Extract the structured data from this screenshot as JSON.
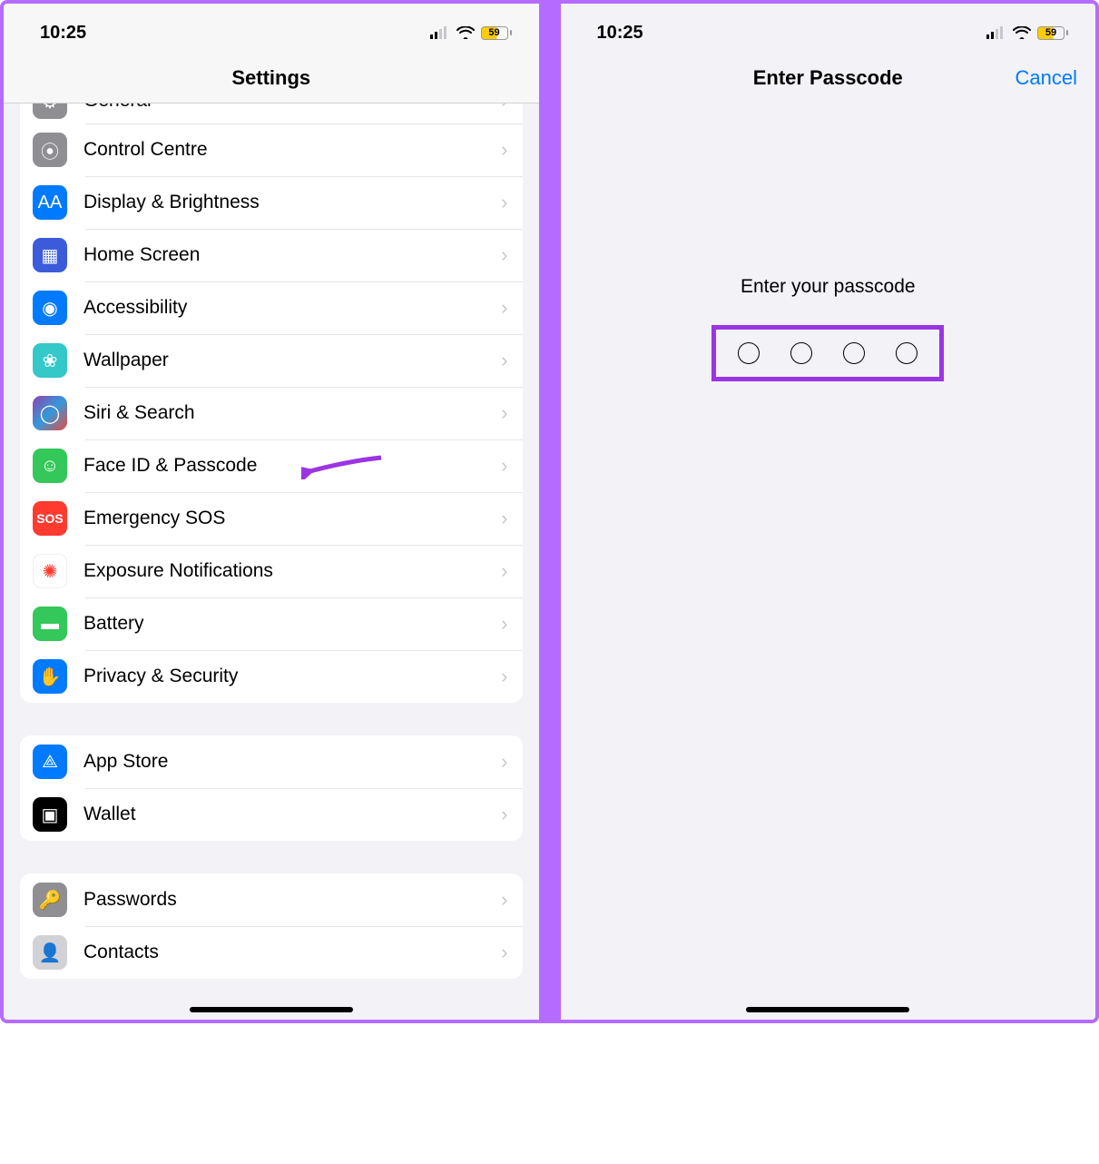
{
  "status": {
    "time": "10:25",
    "battery": "59"
  },
  "left": {
    "title": "Settings",
    "group1": [
      {
        "id": "general",
        "label": "General",
        "iconClass": "ic-general",
        "glyph": "⚙"
      },
      {
        "id": "control",
        "label": "Control Centre",
        "iconClass": "ic-control",
        "glyph": "⦿"
      },
      {
        "id": "display",
        "label": "Display & Brightness",
        "iconClass": "ic-display",
        "glyph": "AA"
      },
      {
        "id": "home",
        "label": "Home Screen",
        "iconClass": "ic-home",
        "glyph": "▦"
      },
      {
        "id": "access",
        "label": "Accessibility",
        "iconClass": "ic-access",
        "glyph": "◉"
      },
      {
        "id": "wall",
        "label": "Wallpaper",
        "iconClass": "ic-wall",
        "glyph": "❀"
      },
      {
        "id": "siri",
        "label": "Siri & Search",
        "iconClass": "ic-siri",
        "glyph": "◯"
      },
      {
        "id": "face",
        "label": "Face ID & Passcode",
        "iconClass": "ic-face",
        "glyph": "☺"
      },
      {
        "id": "sos",
        "label": "Emergency SOS",
        "iconClass": "ic-sos",
        "glyph": "SOS"
      },
      {
        "id": "expo",
        "label": "Exposure Notifications",
        "iconClass": "ic-expo",
        "glyph": "✺"
      },
      {
        "id": "batt",
        "label": "Battery",
        "iconClass": "ic-batt",
        "glyph": "▬"
      },
      {
        "id": "priv",
        "label": "Privacy & Security",
        "iconClass": "ic-priv",
        "glyph": "✋"
      }
    ],
    "group2": [
      {
        "id": "store",
        "label": "App Store",
        "iconClass": "ic-store",
        "glyph": "⟁"
      },
      {
        "id": "wallet",
        "label": "Wallet",
        "iconClass": "ic-wallet",
        "glyph": "▣"
      }
    ],
    "group3": [
      {
        "id": "pass",
        "label": "Passwords",
        "iconClass": "ic-pass",
        "glyph": "🔑"
      },
      {
        "id": "contacts",
        "label": "Contacts",
        "iconClass": "ic-contacts",
        "glyph": "👤"
      }
    ]
  },
  "right": {
    "title": "Enter Passcode",
    "cancel": "Cancel",
    "prompt": "Enter your passcode",
    "digits": 4
  }
}
